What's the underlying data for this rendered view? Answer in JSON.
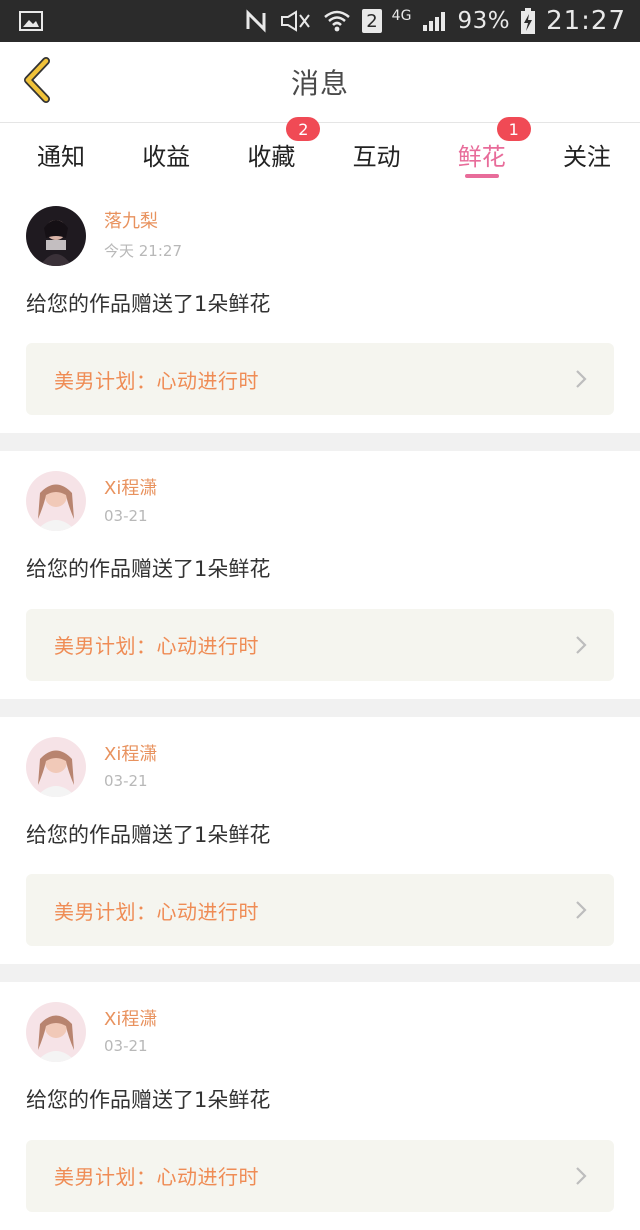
{
  "status_bar": {
    "icons": [
      "gallery-icon",
      "nfc-icon",
      "mute-icon",
      "wifi-icon",
      "signal-icon",
      "battery-icon"
    ],
    "sim_label": "2",
    "network_label": "4G",
    "battery_percent": "93%",
    "time": "21:27"
  },
  "header": {
    "title": "消息",
    "back_icon": "chevron-left-icon",
    "back_color": "#f0c23a"
  },
  "tabs": [
    {
      "label": "通知",
      "badge": null,
      "active": false
    },
    {
      "label": "收益",
      "badge": null,
      "active": false
    },
    {
      "label": "收藏",
      "badge": "2",
      "active": false
    },
    {
      "label": "互动",
      "badge": null,
      "active": false
    },
    {
      "label": "鲜花",
      "badge": "1",
      "active": true
    },
    {
      "label": "关注",
      "badge": null,
      "active": false
    }
  ],
  "colors": {
    "accent": "#e86c9a",
    "name": "#e8925e",
    "badge": "#f04a55",
    "link_bg": "#f5f5ef",
    "link_text": "#ef8c55"
  },
  "notifications": [
    {
      "user_name": "落九梨",
      "time": "今天 21:27",
      "message": "给您的作品赠送了1朵鲜花",
      "work_title": "美男计划：心动进行时"
    },
    {
      "user_name": "Xi程潇",
      "time": "03-21",
      "message": "给您的作品赠送了1朵鲜花",
      "work_title": "美男计划：心动进行时"
    },
    {
      "user_name": "Xi程潇",
      "time": "03-21",
      "message": "给您的作品赠送了1朵鲜花",
      "work_title": "美男计划：心动进行时"
    },
    {
      "user_name": "Xi程潇",
      "time": "03-21",
      "message": "给您的作品赠送了1朵鲜花",
      "work_title": "美男计划：心动进行时"
    }
  ]
}
